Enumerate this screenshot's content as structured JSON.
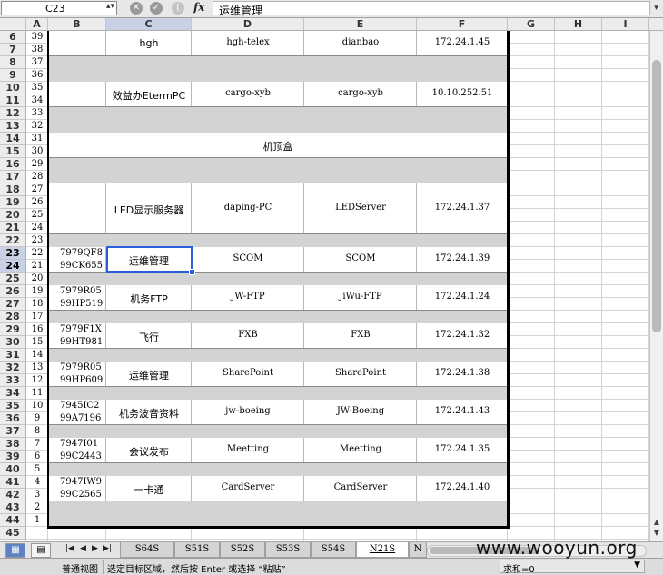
{
  "formula_bar": {
    "name_box": "C23",
    "formula": "运维管理",
    "fx": "fx",
    "cancel": "✕",
    "confirm": "✓",
    "fn_paren": "("
  },
  "columns": [
    {
      "id": "A",
      "label": "A"
    },
    {
      "id": "B",
      "label": "B"
    },
    {
      "id": "C",
      "label": "C"
    },
    {
      "id": "D",
      "label": "D"
    },
    {
      "id": "E",
      "label": "E"
    },
    {
      "id": "F",
      "label": "F"
    },
    {
      "id": "G",
      "label": "G"
    },
    {
      "id": "H",
      "label": "H"
    },
    {
      "id": "I",
      "label": "I"
    }
  ],
  "rows": [
    {
      "r": "6",
      "a": "39"
    },
    {
      "r": "7",
      "a": "38"
    },
    {
      "r": "8",
      "a": "37"
    },
    {
      "r": "9",
      "a": "36"
    },
    {
      "r": "10",
      "a": "35"
    },
    {
      "r": "11",
      "a": "34"
    },
    {
      "r": "12",
      "a": "33"
    },
    {
      "r": "13",
      "a": "32"
    },
    {
      "r": "14",
      "a": "31"
    },
    {
      "r": "15",
      "a": "30"
    },
    {
      "r": "16",
      "a": "29"
    },
    {
      "r": "17",
      "a": "28"
    },
    {
      "r": "18",
      "a": "27"
    },
    {
      "r": "19",
      "a": "26"
    },
    {
      "r": "20",
      "a": "25"
    },
    {
      "r": "21",
      "a": "24"
    },
    {
      "r": "22",
      "a": "23"
    },
    {
      "r": "23",
      "a": "22"
    },
    {
      "r": "24",
      "a": "21"
    },
    {
      "r": "25",
      "a": "20"
    },
    {
      "r": "26",
      "a": "19"
    },
    {
      "r": "27",
      "a": "18"
    },
    {
      "r": "28",
      "a": "17"
    },
    {
      "r": "29",
      "a": "16"
    },
    {
      "r": "30",
      "a": "15"
    },
    {
      "r": "31",
      "a": "14"
    },
    {
      "r": "32",
      "a": "13"
    },
    {
      "r": "33",
      "a": "12"
    },
    {
      "r": "34",
      "a": "11"
    },
    {
      "r": "35",
      "a": "10"
    },
    {
      "r": "36",
      "a": "9"
    },
    {
      "r": "37",
      "a": "8"
    },
    {
      "r": "38",
      "a": "7"
    },
    {
      "r": "39",
      "a": "6"
    },
    {
      "r": "40",
      "a": "5"
    },
    {
      "r": "41",
      "a": "4"
    },
    {
      "r": "42",
      "a": "3"
    },
    {
      "r": "43",
      "a": "2"
    },
    {
      "r": "44",
      "a": "1"
    },
    {
      "r": "45",
      "a": ""
    }
  ],
  "entries": [
    {
      "b": [],
      "c": "hgh",
      "d": "hgh-telex",
      "e": "dianbao",
      "f": "172.24.1.45"
    },
    {
      "b": [],
      "c": "效益办EtermPC",
      "d": "cargo-xyb",
      "e": "cargo-xyb",
      "f": "10.10.252.51"
    },
    {
      "merged": "机顶盒"
    },
    {
      "b": [],
      "c": "LED显示服务器",
      "d": "daping-PC",
      "e": "LEDServer",
      "f": "172.24.1.37"
    },
    {
      "b": [
        "7979QF8",
        "99CK655"
      ],
      "c": "运维管理",
      "d": "SCOM",
      "e": "SCOM",
      "f": "172.24.1.39"
    },
    {
      "b": [
        "7979R05",
        "99HP519"
      ],
      "c": "机务FTP",
      "d": "JW-FTP",
      "e": "JiWu-FTP",
      "f": "172.24.1.24"
    },
    {
      "b": [
        "7979F1X",
        "99HT981"
      ],
      "c": "飞行",
      "d": "FXB",
      "e": "FXB",
      "f": "172.24.1.32"
    },
    {
      "b": [
        "7979R05",
        "99HP609"
      ],
      "c": "运维管理",
      "d": "SharePoint",
      "e": "SharePoint",
      "f": "172.24.1.38"
    },
    {
      "b": [
        "7945IC2",
        "99A7196"
      ],
      "c": "机务波音资料",
      "d": "jw-boeing",
      "e": "JW-Boeing",
      "f": "172.24.1.43"
    },
    {
      "b": [
        "7947I01",
        "99C2443"
      ],
      "c": "会议发布",
      "d": "Meetting",
      "e": "Meetting",
      "f": "172.24.1.35"
    },
    {
      "b": [
        "7947IW9",
        "99C2565"
      ],
      "c": "一卡通",
      "d": "CardServer",
      "e": "CardServer",
      "f": "172.24.1.40"
    }
  ],
  "sheet_tabs": [
    "S64S",
    "S51S",
    "S52S",
    "S53S",
    "S54S",
    "N21S",
    "N"
  ],
  "active_tab": "N21S",
  "status": {
    "view_mode": "普通视图",
    "message": "选定目标区域，然后按 Enter 或选择 “粘贴”",
    "sum": "求和=0"
  },
  "watermark": "www.wooyun.org",
  "colors": {
    "selection": "#2b5fd9",
    "gray_row": "#d3d3d3",
    "header_selected": "#c8d2e4"
  }
}
